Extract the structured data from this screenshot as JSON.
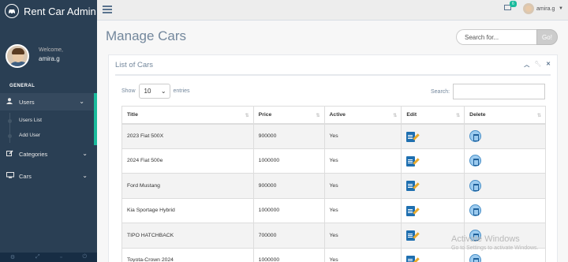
{
  "brand": {
    "title": "Rent Car Admin"
  },
  "profile": {
    "welcome": "Welcome,",
    "name": "amira.g"
  },
  "sidebar": {
    "section": "GENERAL",
    "items": [
      {
        "label": "Users",
        "icon": "user-icon"
      },
      {
        "label": "Categories",
        "icon": "edit-icon"
      },
      {
        "label": "Cars",
        "icon": "desktop-icon"
      }
    ],
    "users_submenu": [
      "Users List",
      "Add User"
    ]
  },
  "topnav": {
    "badge": "6",
    "user": "amira.g"
  },
  "page": {
    "title": "Manage Cars"
  },
  "search": {
    "placeholder": "Search for...",
    "button": "Go!"
  },
  "panel": {
    "title": "List of Cars"
  },
  "datatable": {
    "show_label": "Show",
    "entries_value": "10",
    "entries_label": "entries",
    "search_label": "Search:",
    "columns": [
      "Title",
      "Price",
      "Active",
      "Edit",
      "Delete"
    ],
    "rows": [
      {
        "title": "2023 Fiat 500X",
        "price": "900000",
        "active": "Yes"
      },
      {
        "title": "2024 Fiat 500e",
        "price": "1000000",
        "active": "Yes"
      },
      {
        "title": "Ford Mustang",
        "price": "900000",
        "active": "Yes"
      },
      {
        "title": "Kia Sportage Hybrid",
        "price": "1000000",
        "active": "Yes"
      },
      {
        "title": "TIPO HATCHBACK",
        "price": "700000",
        "active": "Yes"
      },
      {
        "title": "Toyota-Crown 2024",
        "price": "1000000",
        "active": "Yes"
      }
    ]
  },
  "watermark": {
    "line1": "Activate Windows",
    "line2": "Go to Settings to activate Windows."
  },
  "colors": {
    "sidebar": "#2a3f54",
    "accent": "#1abb9c",
    "edit": "#1e6fb0",
    "delete": "#9ccbef"
  }
}
